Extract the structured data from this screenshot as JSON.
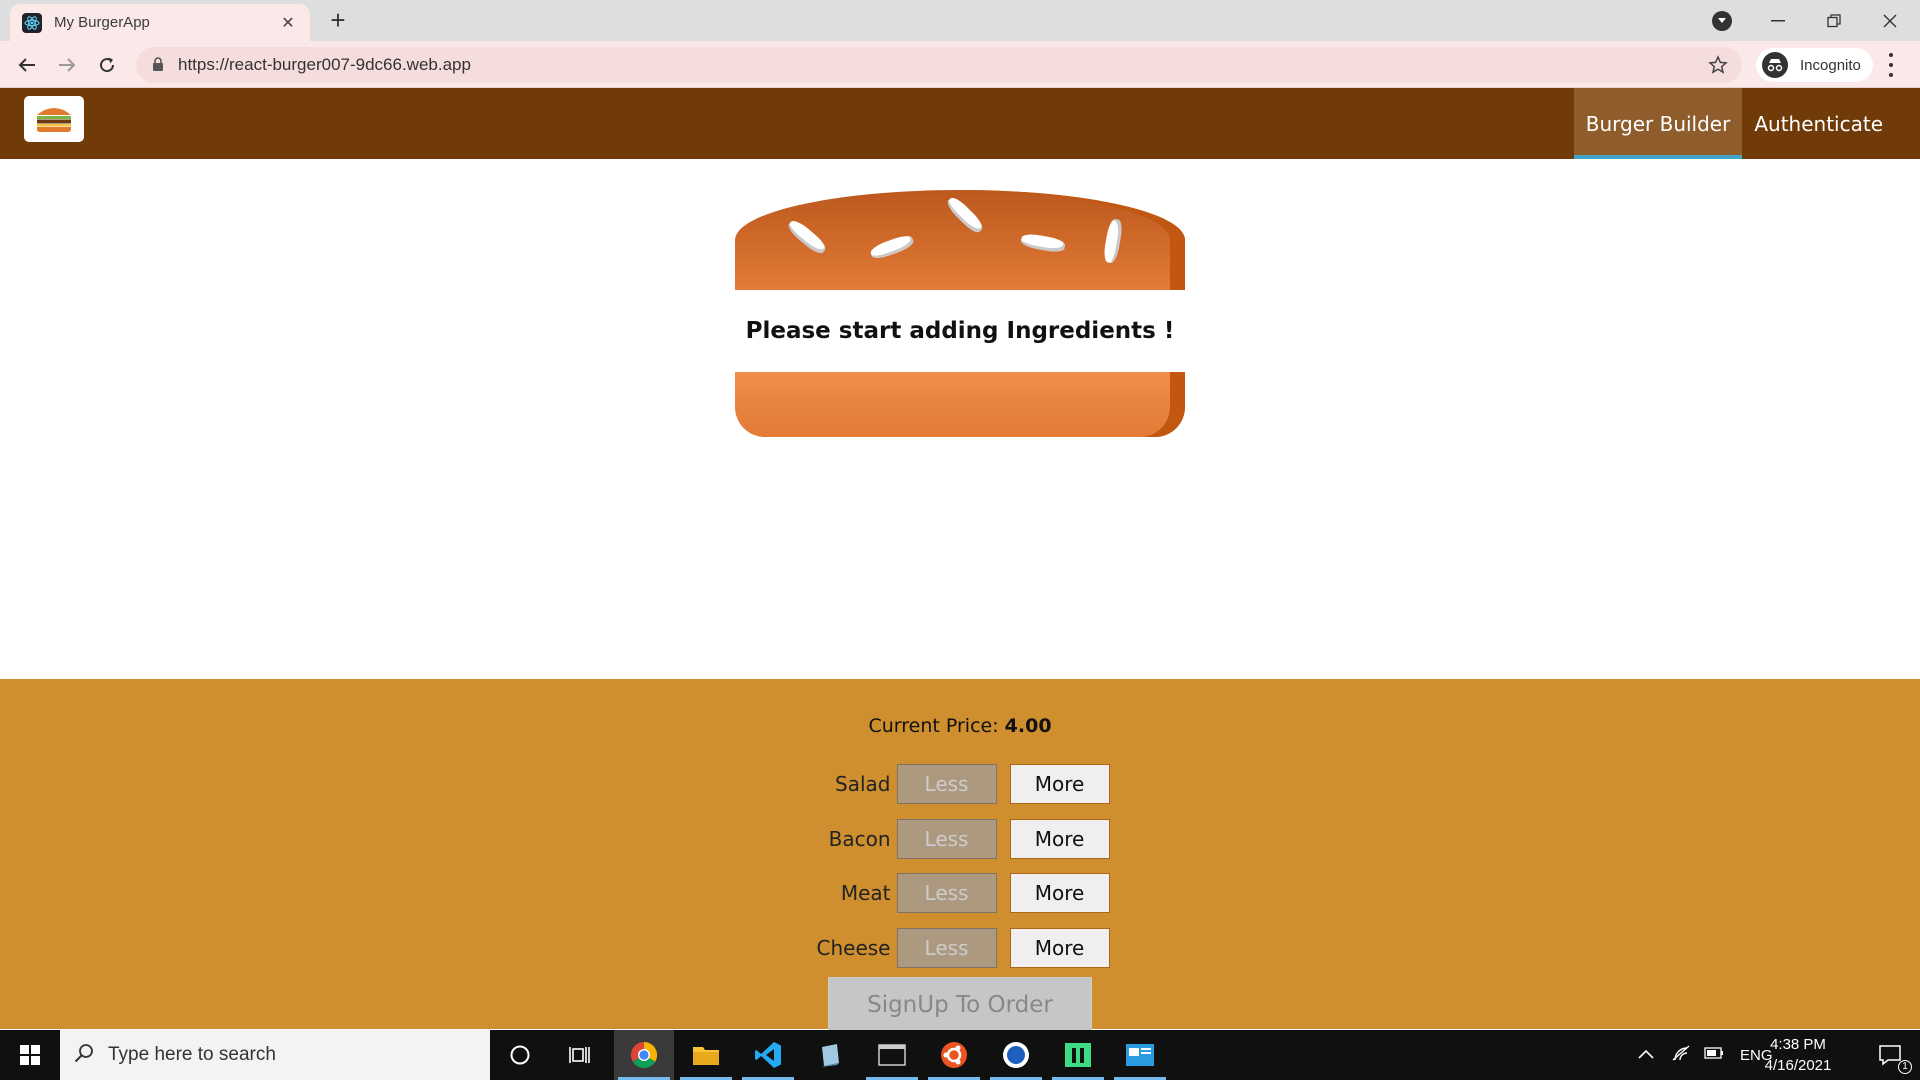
{
  "browser": {
    "tab_title": "My BurgerApp",
    "url": "https://react-burger007-9dc66.web.app",
    "profile_label": "Incognito"
  },
  "app": {
    "nav": [
      {
        "label": "Burger Builder",
        "active": true
      },
      {
        "label": "Authenticate",
        "active": false
      }
    ],
    "burger_message": "Please start adding Ingredients !"
  },
  "controls": {
    "price_label": "Current Price:",
    "price_value": "4.00",
    "less_label": "Less",
    "more_label": "More",
    "ingredients": [
      {
        "label": "Salad"
      },
      {
        "label": "Bacon"
      },
      {
        "label": "Meat"
      },
      {
        "label": "Cheese"
      }
    ],
    "order_button": "SignUp To Order"
  },
  "taskbar": {
    "search_placeholder": "Type here to search",
    "language": "ENG",
    "time": "4:38 PM",
    "date": "4/16/2021",
    "notification_count": "1"
  },
  "colors": {
    "header": "#703b09",
    "controls_bg": "#cf8f2e",
    "active_nav_underline": "#40a4c8"
  }
}
